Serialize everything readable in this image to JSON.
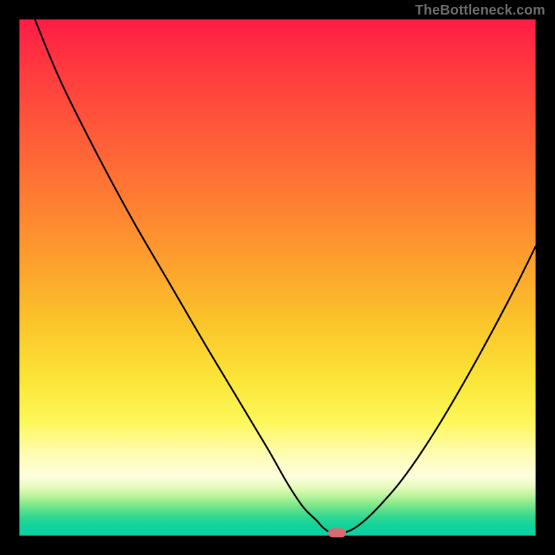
{
  "watermark": "TheBottleneck.com",
  "chart_data": {
    "type": "line",
    "title": "",
    "xlabel": "",
    "ylabel": "",
    "xlim": [
      0,
      100
    ],
    "ylim": [
      0,
      100
    ],
    "grid": false,
    "series": [
      {
        "name": "bottleneck-curve",
        "x": [
          3,
          8,
          15,
          22,
          29,
          36,
          42,
          48,
          52,
          55,
          57.5,
          59,
          60.5,
          63,
          66,
          70,
          75,
          81,
          88,
          95,
          100
        ],
        "y": [
          100,
          88,
          74,
          61,
          49,
          37,
          27,
          17,
          10,
          5.5,
          3,
          1.4,
          0.6,
          0.6,
          2.2,
          6,
          12,
          21,
          33,
          46,
          56
        ]
      }
    ],
    "marker": {
      "x": 61.5,
      "y": 0.6,
      "color": "#d96a6f"
    },
    "background_gradient": {
      "stops": [
        {
          "pos": 0.0,
          "color": "#ff1c46"
        },
        {
          "pos": 0.28,
          "color": "#ff6a36"
        },
        {
          "pos": 0.58,
          "color": "#fbc22a"
        },
        {
          "pos": 0.78,
          "color": "#fdf75a"
        },
        {
          "pos": 0.9,
          "color": "#e9fbc0"
        },
        {
          "pos": 1.0,
          "color": "#09d2a4"
        }
      ]
    }
  }
}
